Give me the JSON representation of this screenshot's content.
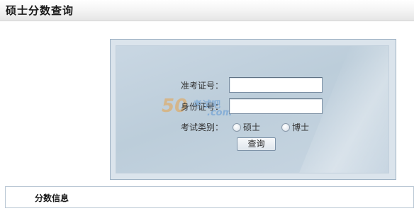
{
  "header": {
    "title": "硕士分数查询"
  },
  "form": {
    "exam_id_label": "准考证号：",
    "exam_id_value": "",
    "id_card_label": "身份证号：",
    "id_card_value": "",
    "category_label": "考试类别：",
    "options": [
      {
        "label": "硕士",
        "selected": false
      },
      {
        "label": "博士",
        "selected": false
      }
    ],
    "submit_label": "查询"
  },
  "watermark": {
    "number": "50",
    "site": "考试吧",
    "domain": ".com"
  },
  "info": {
    "title": "分数信息"
  }
}
